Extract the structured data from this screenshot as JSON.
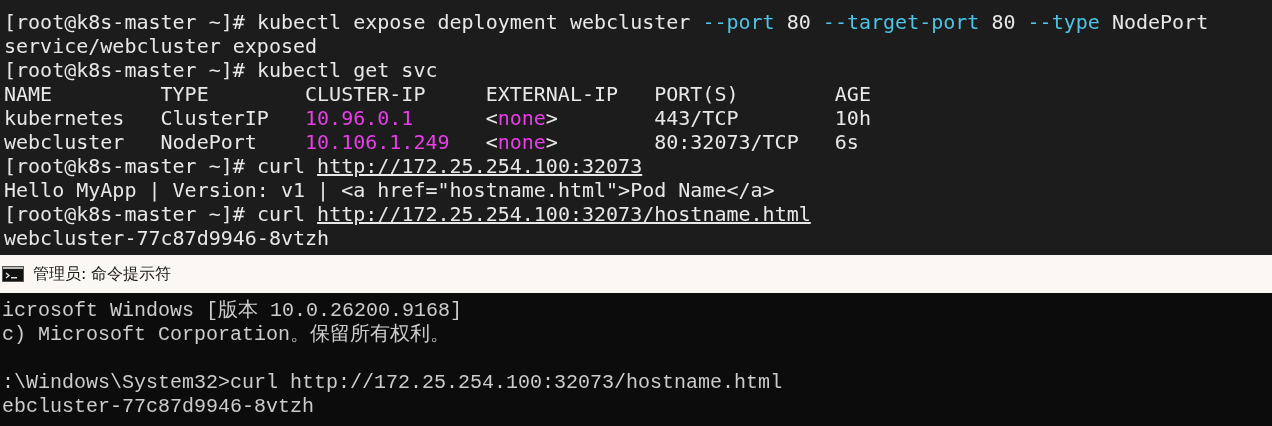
{
  "terminal": {
    "lines": [
      {
        "kind": "prompt",
        "prompt": "[root@k8s-master ~]#",
        "parts": [
          {
            "text": "kubectl expose deployment webcluster",
            "kind": "plain"
          },
          {
            "text": "--port",
            "kind": "option"
          },
          {
            "text": "80",
            "kind": "plain"
          },
          {
            "text": "--target-port",
            "kind": "option"
          },
          {
            "text": "80",
            "kind": "plain"
          },
          {
            "text": "--type",
            "kind": "option"
          },
          {
            "text": "NodePort",
            "kind": "plain"
          }
        ]
      },
      {
        "kind": "output",
        "text": "service/webcluster exposed"
      },
      {
        "kind": "prompt",
        "prompt": "[root@k8s-master ~]#",
        "parts": [
          {
            "text": "kubectl get svc",
            "kind": "plain"
          }
        ]
      },
      {
        "kind": "table",
        "columns": [
          "NAME",
          "TYPE",
          "CLUSTER-IP",
          "EXTERNAL-IP",
          "PORT(S)",
          "AGE"
        ],
        "rows": [
          [
            [
              {
                "text": "kubernetes",
                "kind": "plain"
              }
            ],
            [
              {
                "text": "ClusterIP",
                "kind": "plain"
              }
            ],
            [
              {
                "text": "10.96.0.1",
                "kind": "value"
              }
            ],
            [
              {
                "text": "<",
                "kind": "plain"
              },
              {
                "text": "none",
                "kind": "value"
              },
              {
                "text": ">",
                "kind": "plain"
              }
            ],
            [
              {
                "text": "443/TCP",
                "kind": "plain"
              }
            ],
            [
              {
                "text": "10h",
                "kind": "plain"
              }
            ]
          ],
          [
            [
              {
                "text": "webcluster",
                "kind": "plain"
              }
            ],
            [
              {
                "text": "NodePort",
                "kind": "plain"
              }
            ],
            [
              {
                "text": "10.106.1.249",
                "kind": "value"
              }
            ],
            [
              {
                "text": "<",
                "kind": "plain"
              },
              {
                "text": "none",
                "kind": "value"
              },
              {
                "text": ">",
                "kind": "plain"
              }
            ],
            [
              {
                "text": "80:32073/TCP",
                "kind": "plain"
              }
            ],
            [
              {
                "text": "6s",
                "kind": "plain"
              }
            ]
          ]
        ]
      },
      {
        "kind": "prompt",
        "prompt": "[root@k8s-master ~]#",
        "parts": [
          {
            "text": "curl",
            "kind": "plain"
          },
          {
            "text": "http://172.25.254.100:32073",
            "kind": "link"
          }
        ]
      },
      {
        "kind": "output",
        "text": "Hello MyApp | Version: v1 | <a href=\"hostname.html\">Pod Name</a>"
      },
      {
        "kind": "prompt",
        "prompt": "[root@k8s-master ~]#",
        "parts": [
          {
            "text": "curl",
            "kind": "plain"
          },
          {
            "text": "http://172.25.254.100:32073/hostname.html",
            "kind": "link"
          }
        ]
      },
      {
        "kind": "output",
        "text": "webcluster-77c87d9946-8vtzh"
      }
    ]
  },
  "cmd_window": {
    "title": "管理员: 命令提示符",
    "paragraphs": [
      [
        "icrosoft Windows [版本 10.0.26200.9168]",
        "c) Microsoft Corporation。保留所有权利。"
      ],
      [
        ":\\Windows\\System32>curl http://172.25.254.100:32073/hostname.html",
        "ebcluster-77c87d9946-8vtzh"
      ]
    ]
  }
}
